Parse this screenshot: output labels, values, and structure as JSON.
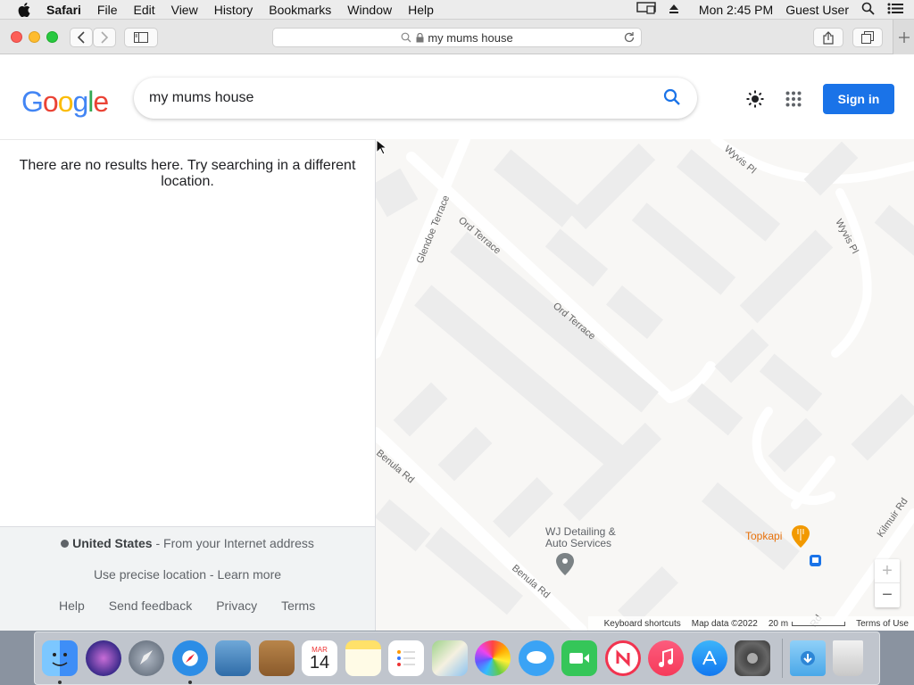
{
  "menubar": {
    "items": [
      "Safari",
      "File",
      "Edit",
      "View",
      "History",
      "Bookmarks",
      "Window",
      "Help"
    ],
    "clock": "Mon 2:45 PM",
    "user": "Guest User"
  },
  "browser": {
    "url": "my mums house"
  },
  "header": {
    "logo_letters": [
      "G",
      "o",
      "o",
      "g",
      "l",
      "e"
    ],
    "search_value": "my mums house",
    "signin_label": "Sign in"
  },
  "results": {
    "message": "There are no results here. Try searching in a different location."
  },
  "footer": {
    "country": "United States",
    "country_source": " - From your Internet address",
    "precise": "Use precise location - Learn more",
    "links": [
      "Help",
      "Send feedback",
      "Privacy",
      "Terms"
    ]
  },
  "map": {
    "streets": [
      "Wyvis Pl",
      "Wyvis Pl",
      "Glendoe Terrace",
      "Ord Terrace",
      "Ord Terrace",
      "Benula Rd",
      "Benula Rd",
      "Kilmuir Rd",
      "Rd"
    ],
    "places": [
      {
        "name": "WJ Detailing & Auto Services"
      },
      {
        "name": "Topkapi"
      }
    ],
    "bottom_bar": {
      "shortcuts": "Keyboard shortcuts",
      "map_data": "Map data ©2022",
      "scale": "20 m",
      "terms": "Terms of Use"
    },
    "zoom_in": "+",
    "zoom_out": "−"
  },
  "dock": {
    "apps": [
      "finder-icon",
      "siri-icon",
      "launchpad-icon",
      "safari-icon",
      "preview-icon",
      "contacts-icon",
      "calendar-icon",
      "notes-icon",
      "reminders-icon",
      "maps-icon",
      "photos-icon",
      "messages-icon",
      "facetime-icon",
      "news-icon",
      "music-icon",
      "app-store-icon",
      "system-preferences-icon",
      "downloads-folder-icon",
      "trash-icon"
    ],
    "calendar_month": "MAR",
    "calendar_day": "14"
  }
}
